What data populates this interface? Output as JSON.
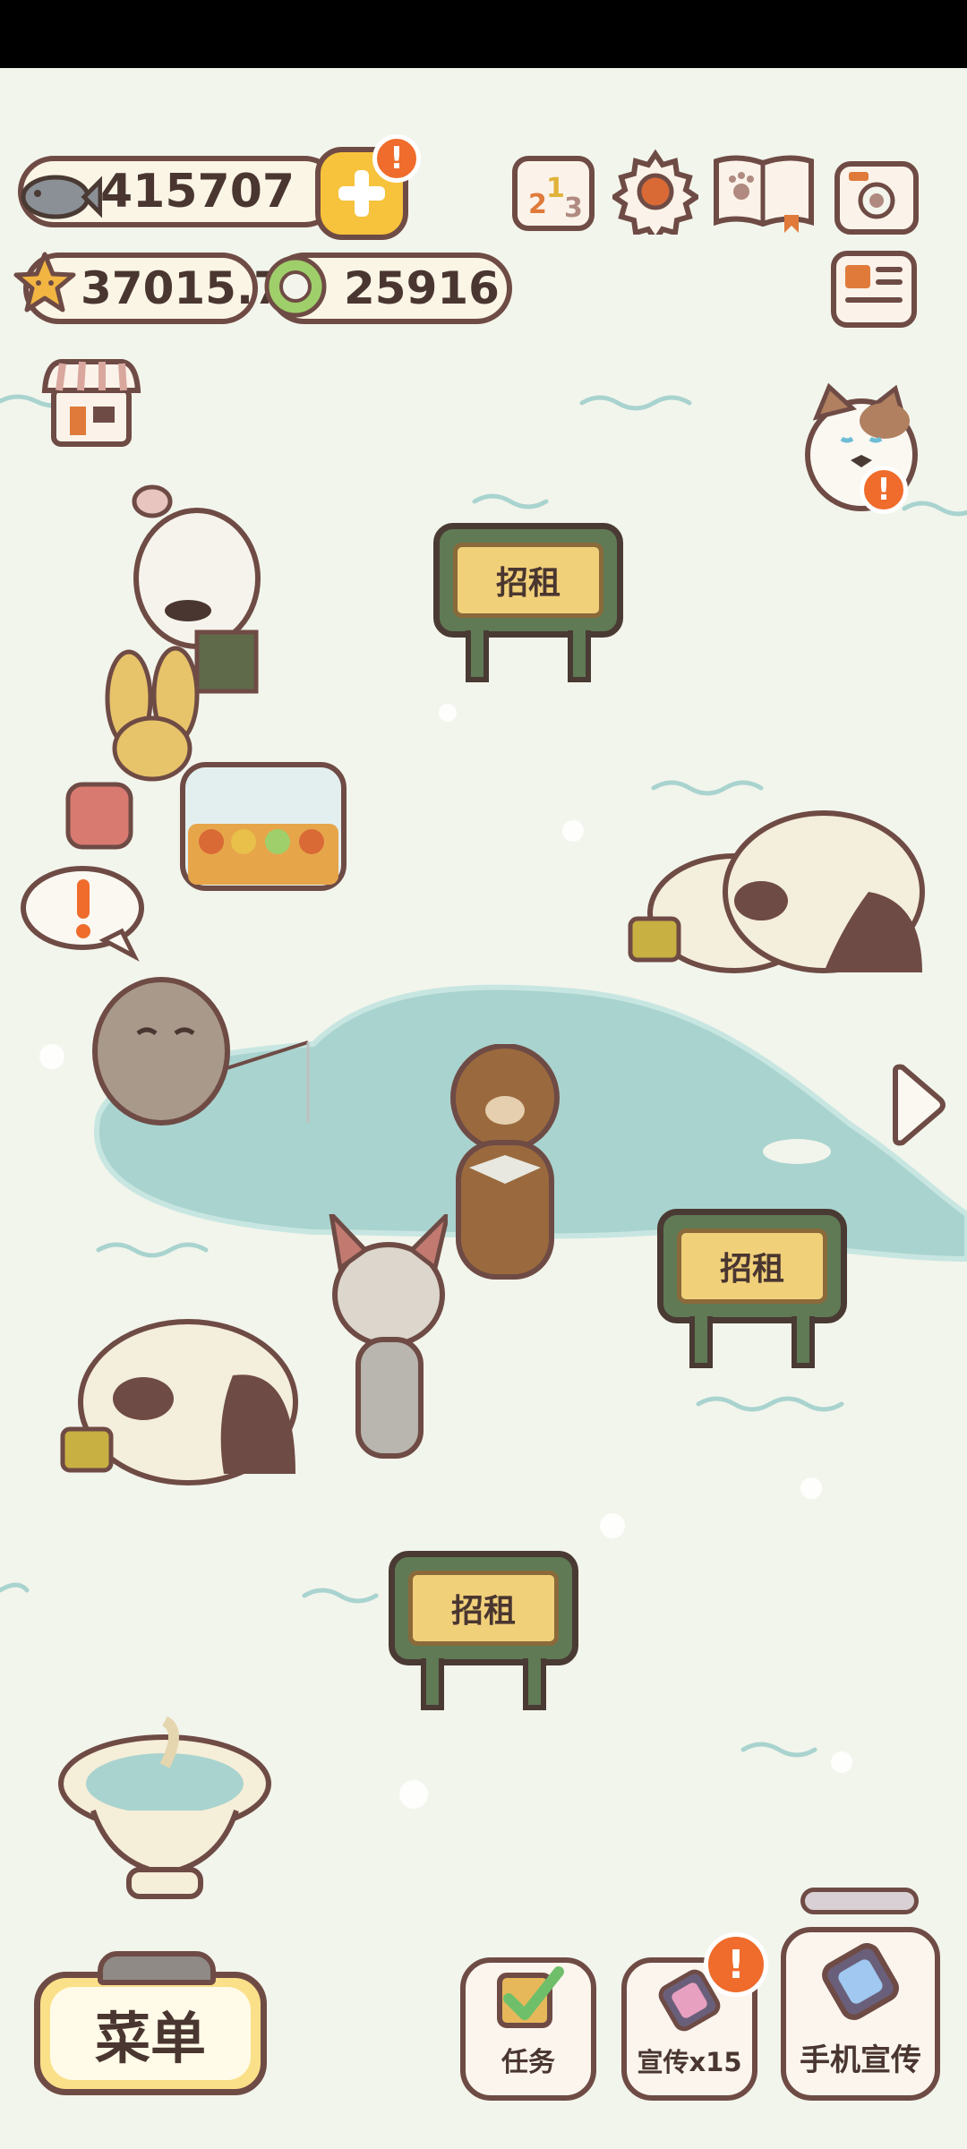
{
  "hud": {
    "fish_count": "415707",
    "star_count": "37015.7",
    "coin_count": "25916",
    "alert_mark": "!"
  },
  "signs": [
    {
      "label": "招租"
    },
    {
      "label": "招租"
    },
    {
      "label": "招租"
    }
  ],
  "bottom_bar": {
    "menu_label": "菜单",
    "tasks_label": "任务",
    "promote_label": "宣传x15",
    "phone_promote_label": "手机宣传"
  },
  "colors": {
    "background": "#f2f5ec",
    "pond": "#a9d3cf",
    "outline": "#6f4b45",
    "accent_yellow": "#f7c23c",
    "alert_orange": "#ef6c2c"
  },
  "icons": [
    "fish-icon",
    "plus-icon",
    "leaderboard-icon",
    "settings-gear-icon",
    "paw-book-icon",
    "camera-icon",
    "star-icon",
    "coin-icon",
    "newspaper-icon",
    "shop-icon",
    "calico-cat-icon",
    "arrow-right-icon",
    "checkbox-icon",
    "phone-icon",
    "fountain-icon"
  ]
}
